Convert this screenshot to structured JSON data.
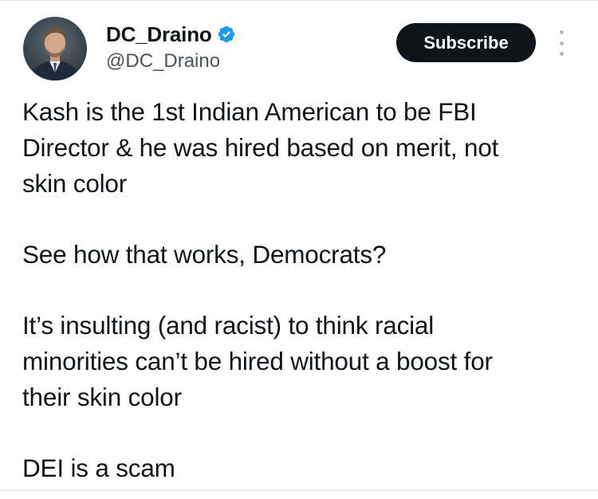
{
  "author": {
    "display_name": "DC_Draino",
    "handle": "@DC_Draino",
    "verified": true,
    "verified_badge_icon": "verified-badge-icon",
    "verified_badge_color": "#1d9bf0"
  },
  "actions": {
    "subscribe_label": "Subscribe",
    "more_icon": "more-vertical-icon"
  },
  "tweet": {
    "paragraphs": [
      "Kash is the 1st Indian American to be FBI\nDirector & he was hired based on merit, not\nskin color",
      "See how that works, Democrats?",
      "It’s insulting (and racist) to think racial\nminorities can’t be hired without a boost for\ntheir skin color",
      "DEI is a scam"
    ]
  },
  "colors": {
    "text": "#0f1419",
    "secondary_text": "#4b5258",
    "button_bg": "#0f1419",
    "button_text": "#ffffff"
  }
}
